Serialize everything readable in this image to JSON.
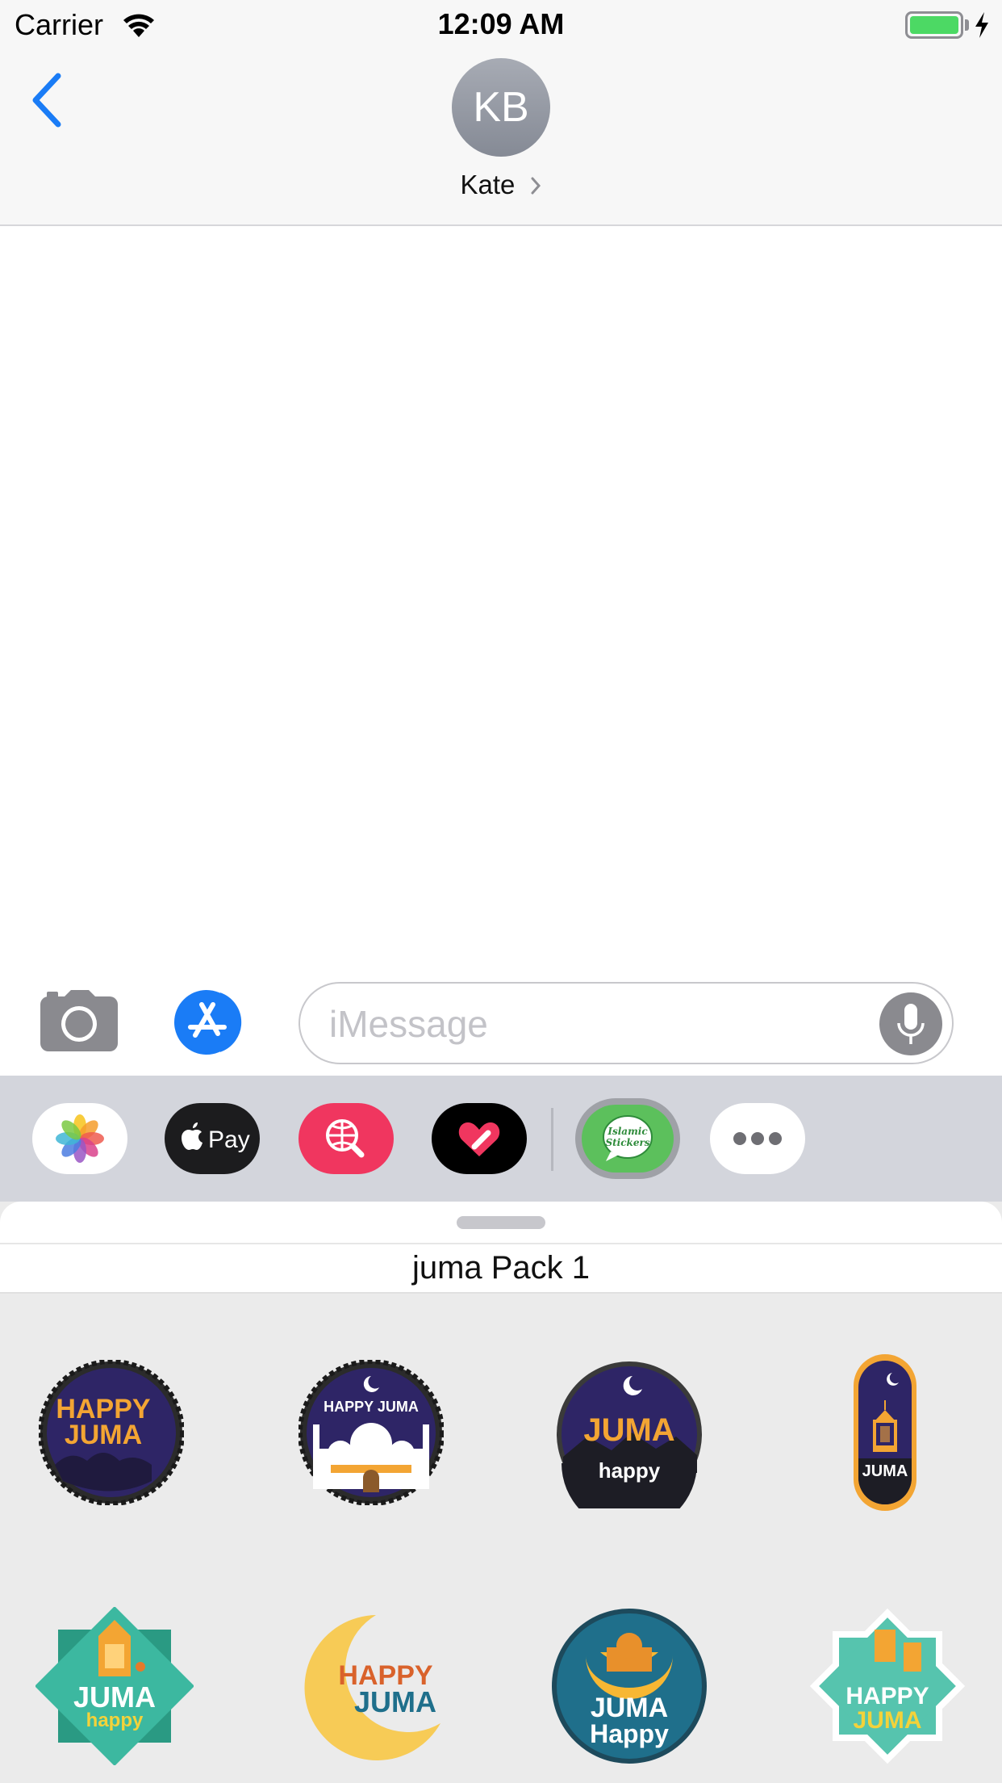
{
  "status_bar": {
    "carrier": "Carrier",
    "time": "12:09 AM",
    "battery_level": 1.0
  },
  "header": {
    "avatar_initials": "KB",
    "contact_name": "Kate"
  },
  "input_bar": {
    "placeholder": "iMessage"
  },
  "app_drawer": {
    "apps": [
      {
        "name": "photos-app-icon"
      },
      {
        "name": "apple-pay-app-icon",
        "label": "Pay"
      },
      {
        "name": "search-images-app-icon"
      },
      {
        "name": "digital-touch-app-icon"
      },
      {
        "name": "islamic-stickers-app-icon",
        "label_line1": "Islamic",
        "label_line2": "Stickers",
        "selected": true
      },
      {
        "name": "more-apps-icon"
      }
    ]
  },
  "sticker_panel": {
    "title": "juma Pack 1",
    "stickers": [
      {
        "line1": "HAPPY",
        "line2": "JUMA"
      },
      {
        "line1": "HAPPY JUMA"
      },
      {
        "line1": "JUMA",
        "line2": "happy"
      },
      {
        "line1": "JUMA"
      },
      {
        "line1": "JUMA",
        "line2": "happy"
      },
      {
        "line1": "HAPPY",
        "line2": "JUMA"
      },
      {
        "line1": "JUMA",
        "line2": "Happy"
      },
      {
        "line1": "HAPPY",
        "line2": "JUMA"
      }
    ]
  },
  "colors": {
    "ios_blue": "#1a7cf6",
    "sticker_navy": "#2e2566",
    "sticker_orange": "#f3a533",
    "sticker_teal": "#3cb8a0"
  }
}
